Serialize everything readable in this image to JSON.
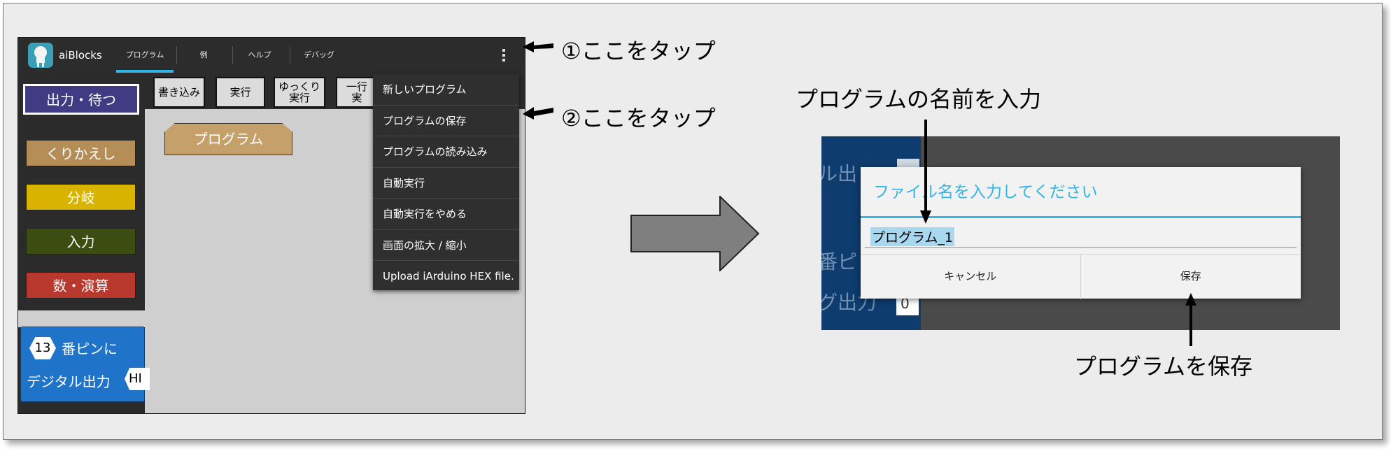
{
  "app": {
    "title": "aiBlocks",
    "tabs": [
      "プログラム",
      "例",
      "ヘルプ",
      "デバッグ"
    ],
    "categories": [
      "出力・待つ",
      "くりかえし",
      "分岐",
      "入力",
      "数・演算"
    ],
    "toolbar": {
      "write": "書き込み",
      "run": "実行",
      "slow_run": "ゆっくり\n実行",
      "step_run": "一行\n実"
    },
    "program_block": "プログラム",
    "digital_block": {
      "pin": "13",
      "line1": "番ピンに",
      "line2": "デジタル出力",
      "value": "HI"
    },
    "menu": [
      "新しいプログラム",
      "プログラムの保存",
      "プログラムの読み込み",
      "自動実行",
      "自動実行をやめる",
      "画面の拡大 / 縮小",
      "Upload iArduino HEX file."
    ]
  },
  "annotations": {
    "tap1": "①ここをタップ",
    "tap2": "②ここをタップ",
    "enter_name": "プログラムの名前を入力",
    "save_program": "プログラムを保存"
  },
  "dialog": {
    "title": "ファイル名を入力してください",
    "input_value": "プログラム_1",
    "cancel": "キャンセル",
    "save": "保存",
    "background_text": [
      "ル出",
      "番ピ",
      "グ出力"
    ],
    "background_pin": "0"
  },
  "colors": {
    "accent": "#33b5e5",
    "output_category": "#3f3c83",
    "loop_category": "#b48d57",
    "branch_category": "#d8b400",
    "input_category": "#3b4d10",
    "math_category": "#b8382e",
    "digital_block": "#1f74c9"
  }
}
